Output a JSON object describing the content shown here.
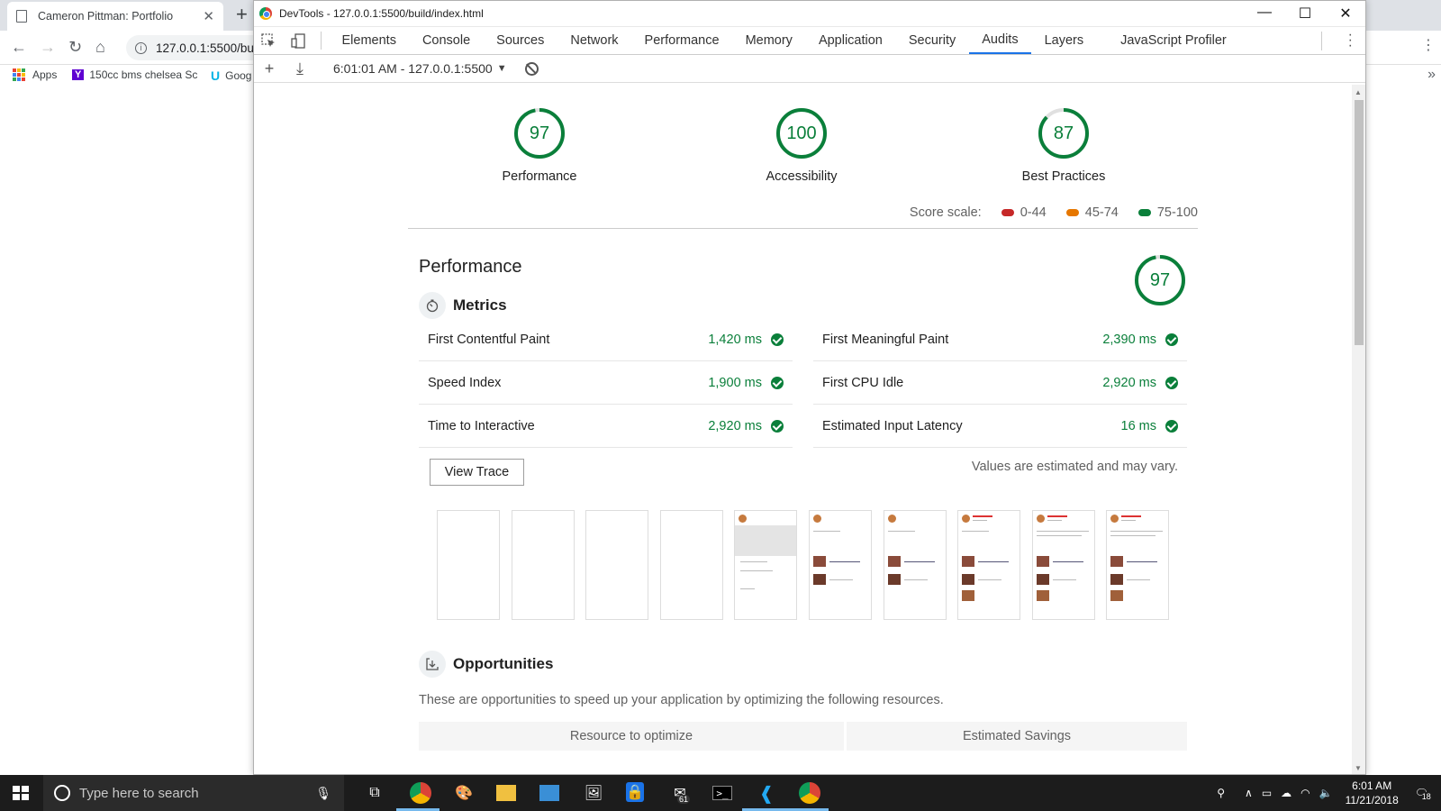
{
  "browser": {
    "tab_title": "Cameron Pittman: Portfolio",
    "url": "127.0.0.1:5500/bui",
    "bookmarks": [
      {
        "label": "Apps",
        "icon": "apps-grid-icon"
      },
      {
        "label": "150cc bms chelsea Sc",
        "icon": "yahoo-icon"
      },
      {
        "label": "Goog",
        "icon": "udacity-icon"
      }
    ]
  },
  "devtools": {
    "window_title": "DevTools - 127.0.0.1:5500/build/index.html",
    "tabs": [
      "Elements",
      "Console",
      "Sources",
      "Network",
      "Performance",
      "Memory",
      "Application",
      "Security",
      "Audits",
      "Layers",
      "JavaScript Profiler"
    ],
    "active_tab": "Audits",
    "report_selector": "6:01:01 AM - 127.0.0.1:5500"
  },
  "report": {
    "gauges": [
      {
        "label": "Performance",
        "score": "97",
        "value": 97
      },
      {
        "label": "Accessibility",
        "score": "100",
        "value": 100
      },
      {
        "label": "Best Practices",
        "score": "87",
        "value": 87
      }
    ],
    "score_scale": {
      "label": "Score scale:",
      "ranges": [
        {
          "label": "0-44",
          "color": "#c62828"
        },
        {
          "label": "45-74",
          "color": "#e67700"
        },
        {
          "label": "75-100",
          "color": "#0a7f3a"
        }
      ]
    },
    "performance": {
      "title": "Performance",
      "score": "97",
      "value": 97,
      "metrics_title": "Metrics",
      "metrics": [
        {
          "name": "First Contentful Paint",
          "value": "1,420 ms"
        },
        {
          "name": "First Meaningful Paint",
          "value": "2,390 ms"
        },
        {
          "name": "Speed Index",
          "value": "1,900 ms"
        },
        {
          "name": "First CPU Idle",
          "value": "2,920 ms"
        },
        {
          "name": "Time to Interactive",
          "value": "2,920 ms"
        },
        {
          "name": "Estimated Input Latency",
          "value": "16 ms"
        }
      ],
      "view_trace": "View Trace",
      "disclaimer": "Values are estimated and may vary.",
      "filmstrip_frames": 10,
      "opportunities_title": "Opportunities",
      "opportunities_desc": "These are opportunities to speed up your application by optimizing the following resources.",
      "opportunities_columns": [
        "Resource to optimize",
        "Estimated Savings"
      ]
    },
    "colors": {
      "pass": "#0a7f3a",
      "accent": "#1a73e8"
    }
  },
  "taskbar": {
    "search_placeholder": "Type here to search",
    "time": "6:01 AM",
    "date": "11/21/2018",
    "mail_badge": "61",
    "notification_count": "18"
  }
}
